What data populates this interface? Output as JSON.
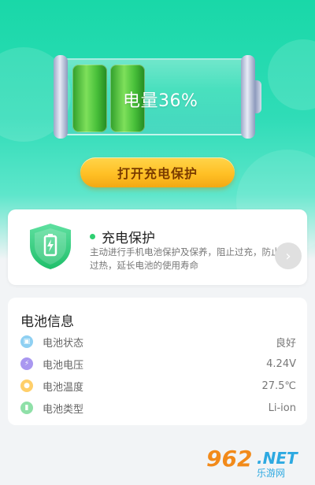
{
  "battery": {
    "level_text": "电量36%",
    "level_fraction": 0.36,
    "fill_color": "#4cc13a"
  },
  "actions": {
    "open_protect_label": "打开充电保护"
  },
  "protect_card": {
    "title": "充电保护",
    "description": "主动进行手机电池保护及保养，阻止过充，防止过热，延长电池的使用寿命",
    "status_color": "#2fcf71",
    "icon": "shield-battery-icon",
    "arrow_icon": "chevron-right-icon"
  },
  "battery_info": {
    "title": "电池信息",
    "rows": [
      {
        "label": "电池状态",
        "value": "良好",
        "icon": "status-icon",
        "color": "#8fd0f2"
      },
      {
        "label": "电池电压",
        "value": "4.24V",
        "icon": "bolt-icon",
        "color": "#a997f0"
      },
      {
        "label": "电池温度",
        "value": "27.5℃",
        "icon": "flame-icon",
        "color": "#ffcf6a"
      },
      {
        "label": "电池类型",
        "value": "Li-ion",
        "icon": "battery-type-icon",
        "color": "#8fe0a8"
      }
    ]
  },
  "watermark": {
    "num": "962",
    "net": ".NET",
    "cn": "乐游网"
  }
}
